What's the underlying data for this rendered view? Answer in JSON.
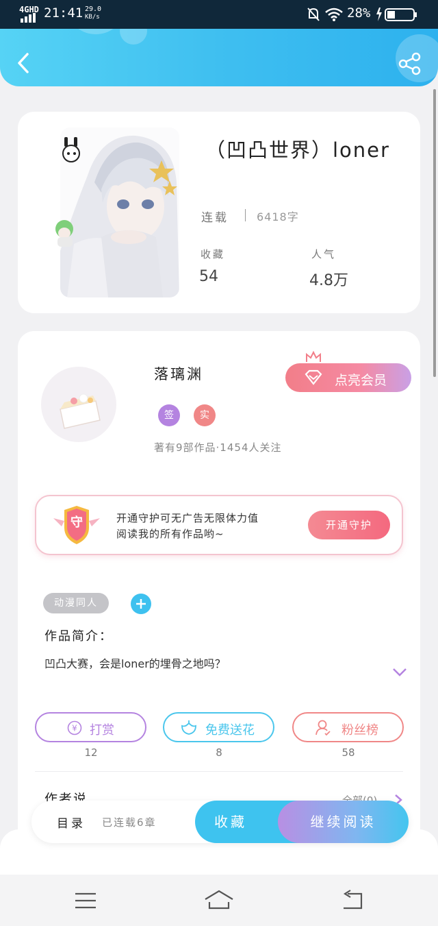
{
  "status": {
    "network": "4GHD",
    "time": "21:41",
    "speed": "29.0",
    "speed_unit": "KB/s",
    "battery": "28%"
  },
  "book": {
    "title": "（凹凸世界）loner",
    "status": "连载",
    "word_count": "6418字",
    "collect_label": "收藏",
    "collect_value": "54",
    "popularity_label": "人气",
    "popularity_value": "4.8万"
  },
  "author": {
    "name": "落璃渊",
    "badge_sign": "签",
    "badge_real": "实",
    "meta": "著有9部作品·1454人关注",
    "vip_button": "点亮会员"
  },
  "guard": {
    "badge": "守",
    "line1": "开通守护可无广告无限体力值",
    "line2": "阅读我的所有作品哟~",
    "button": "开通守护"
  },
  "tags": [
    "动漫同人"
  ],
  "intro": {
    "heading": "作品简介：",
    "text": "凹凸大赛，会是loner的埋骨之地吗？"
  },
  "actions": [
    {
      "label": "打赏",
      "count": "12",
      "color": "#b483e0"
    },
    {
      "label": "免费送花",
      "count": "8",
      "color": "#4ac6ec"
    },
    {
      "label": "粉丝榜",
      "count": "58",
      "color": "#f08787"
    }
  ],
  "author_says": {
    "heading": "作者说",
    "all": "全部(0)"
  },
  "bottom_bar": {
    "toc": "目录",
    "chapters": "已连载6章",
    "collect": "收藏",
    "continue": "继续阅读"
  },
  "colors": {
    "header": "#3fbff0",
    "accent_pink": "#f27e89",
    "accent_purple": "#b483e0"
  }
}
